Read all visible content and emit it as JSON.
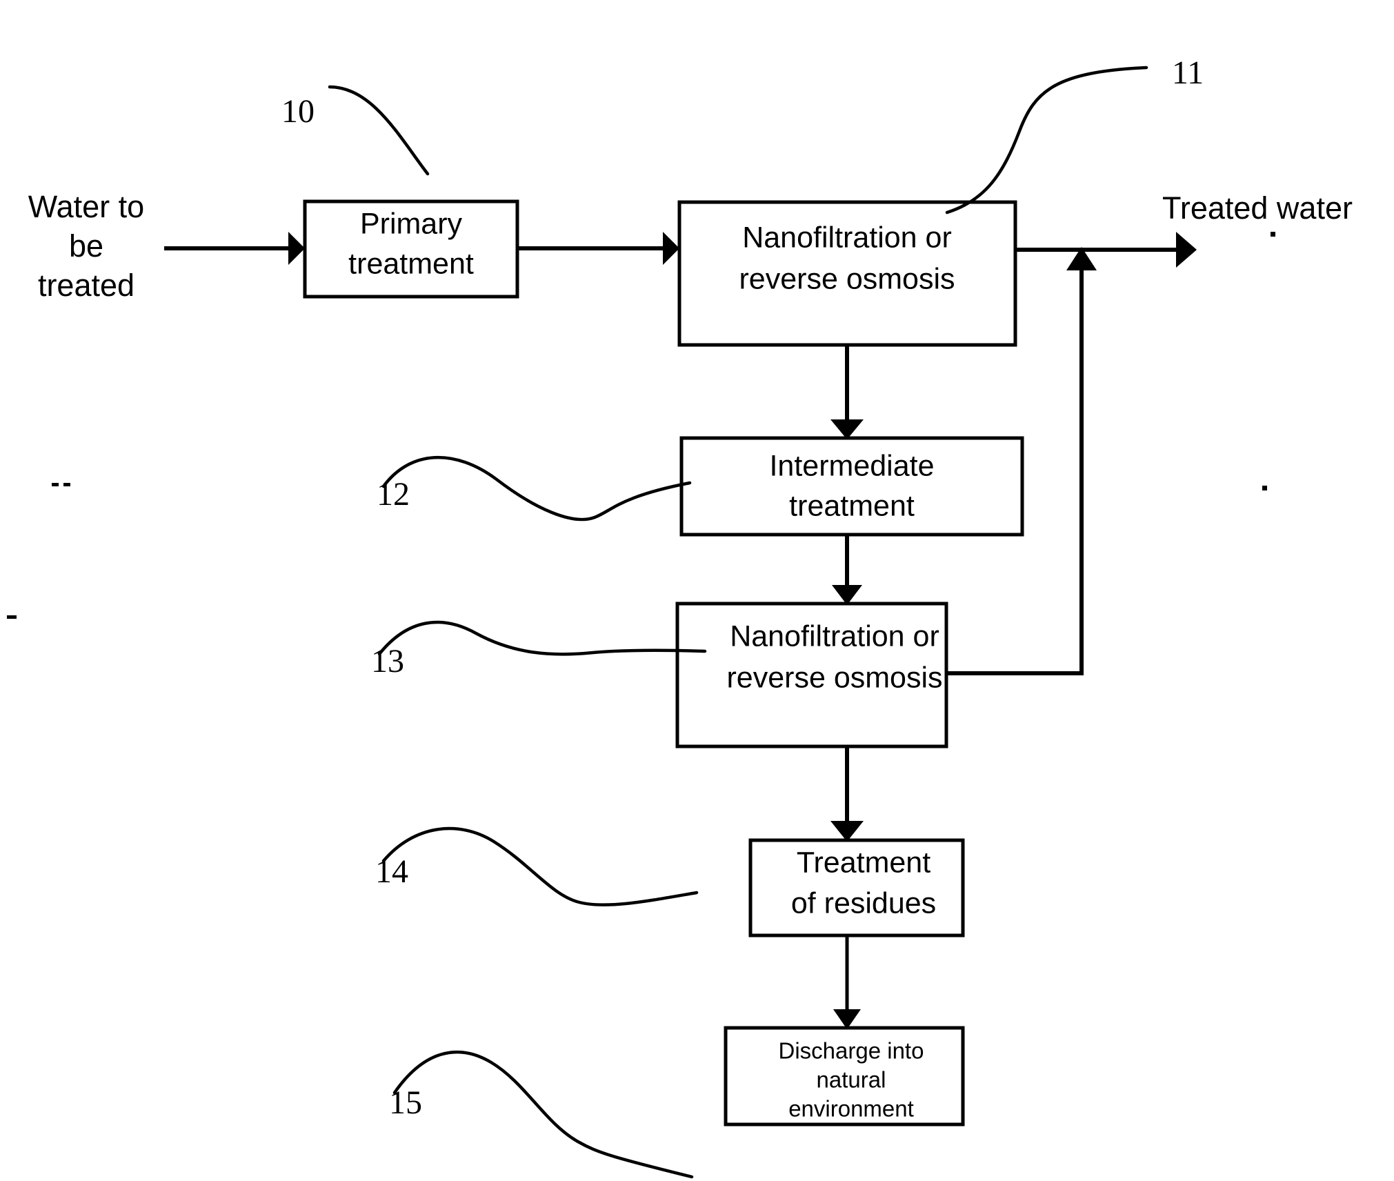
{
  "figure": {
    "type": "patent-process-flow-diagram",
    "title": "Water treatment process flow diagram",
    "background_color": "#ffffff",
    "line_color": "#000000"
  },
  "io_labels": {
    "inlet": {
      "id": "water-to-be-treated",
      "lines": [
        "Water to",
        "be",
        "treated"
      ],
      "line1": "Water to",
      "line2": "be",
      "line3": "treated"
    },
    "outlet": {
      "id": "treated-water",
      "text": "Treated water"
    }
  },
  "boxes": [
    {
      "id": "primary-treatment",
      "ref": "10",
      "lines": [
        "Primary",
        "treatment"
      ],
      "line1": "Primary",
      "line2": "treatment",
      "line3": ""
    },
    {
      "id": "nanofiltration-reverse-osmosis-1",
      "ref": "11",
      "lines": [
        "Nanofiltration or",
        "reverse osmosis"
      ],
      "line1": "Nanofiltration or",
      "line2": "reverse osmosis",
      "line3": ""
    },
    {
      "id": "intermediate-treatment",
      "ref": "12",
      "lines": [
        "Intermediate",
        "treatment"
      ],
      "line1": "Intermediate",
      "line2": "treatment",
      "line3": ""
    },
    {
      "id": "nanofiltration-reverse-osmosis-2",
      "ref": "13",
      "lines": [
        "Nanofiltration or",
        "reverse osmosis"
      ],
      "line1": "Nanofiltration or",
      "line2": "reverse osmosis",
      "line3": ""
    },
    {
      "id": "treatment-of-residues",
      "ref": "14",
      "lines": [
        "Treatment",
        "of residues"
      ],
      "line1": "Treatment",
      "line2": "of residues",
      "line3": ""
    },
    {
      "id": "discharge-into-natural-environment",
      "ref": "15",
      "lines": [
        "Discharge into",
        "natural",
        "environment"
      ],
      "line1": "Discharge into",
      "line2": "natural",
      "line3": "environment"
    }
  ],
  "reference_numerals": {
    "n10": "10",
    "n11": "11",
    "n12": "12",
    "n13": "13",
    "n14": "14",
    "n15": "15"
  },
  "flows": [
    {
      "id": "inlet-to-primary",
      "from": "water-to-be-treated",
      "to": "primary-treatment",
      "arrow": true
    },
    {
      "id": "primary-to-nf1",
      "from": "primary-treatment",
      "to": "nanofiltration-reverse-osmosis-1",
      "arrow": true
    },
    {
      "id": "nf1-to-treated-water",
      "from": "nanofiltration-reverse-osmosis-1",
      "to": "treated-water",
      "arrow": true
    },
    {
      "id": "nf1-to-intermediate",
      "from": "nanofiltration-reverse-osmosis-1",
      "to": "intermediate-treatment",
      "arrow": true
    },
    {
      "id": "intermediate-to-nf2",
      "from": "intermediate-treatment",
      "to": "nanofiltration-reverse-osmosis-2",
      "arrow": true
    },
    {
      "id": "nf2-recycle-to-treated-water",
      "from": "nanofiltration-reverse-osmosis-2",
      "to": "treated-water",
      "arrow": true
    },
    {
      "id": "nf2-to-residues",
      "from": "nanofiltration-reverse-osmosis-2",
      "to": "treatment-of-residues",
      "arrow": true
    },
    {
      "id": "residues-to-discharge",
      "from": "treatment-of-residues",
      "to": "discharge-into-natural-environment",
      "arrow": true
    }
  ]
}
